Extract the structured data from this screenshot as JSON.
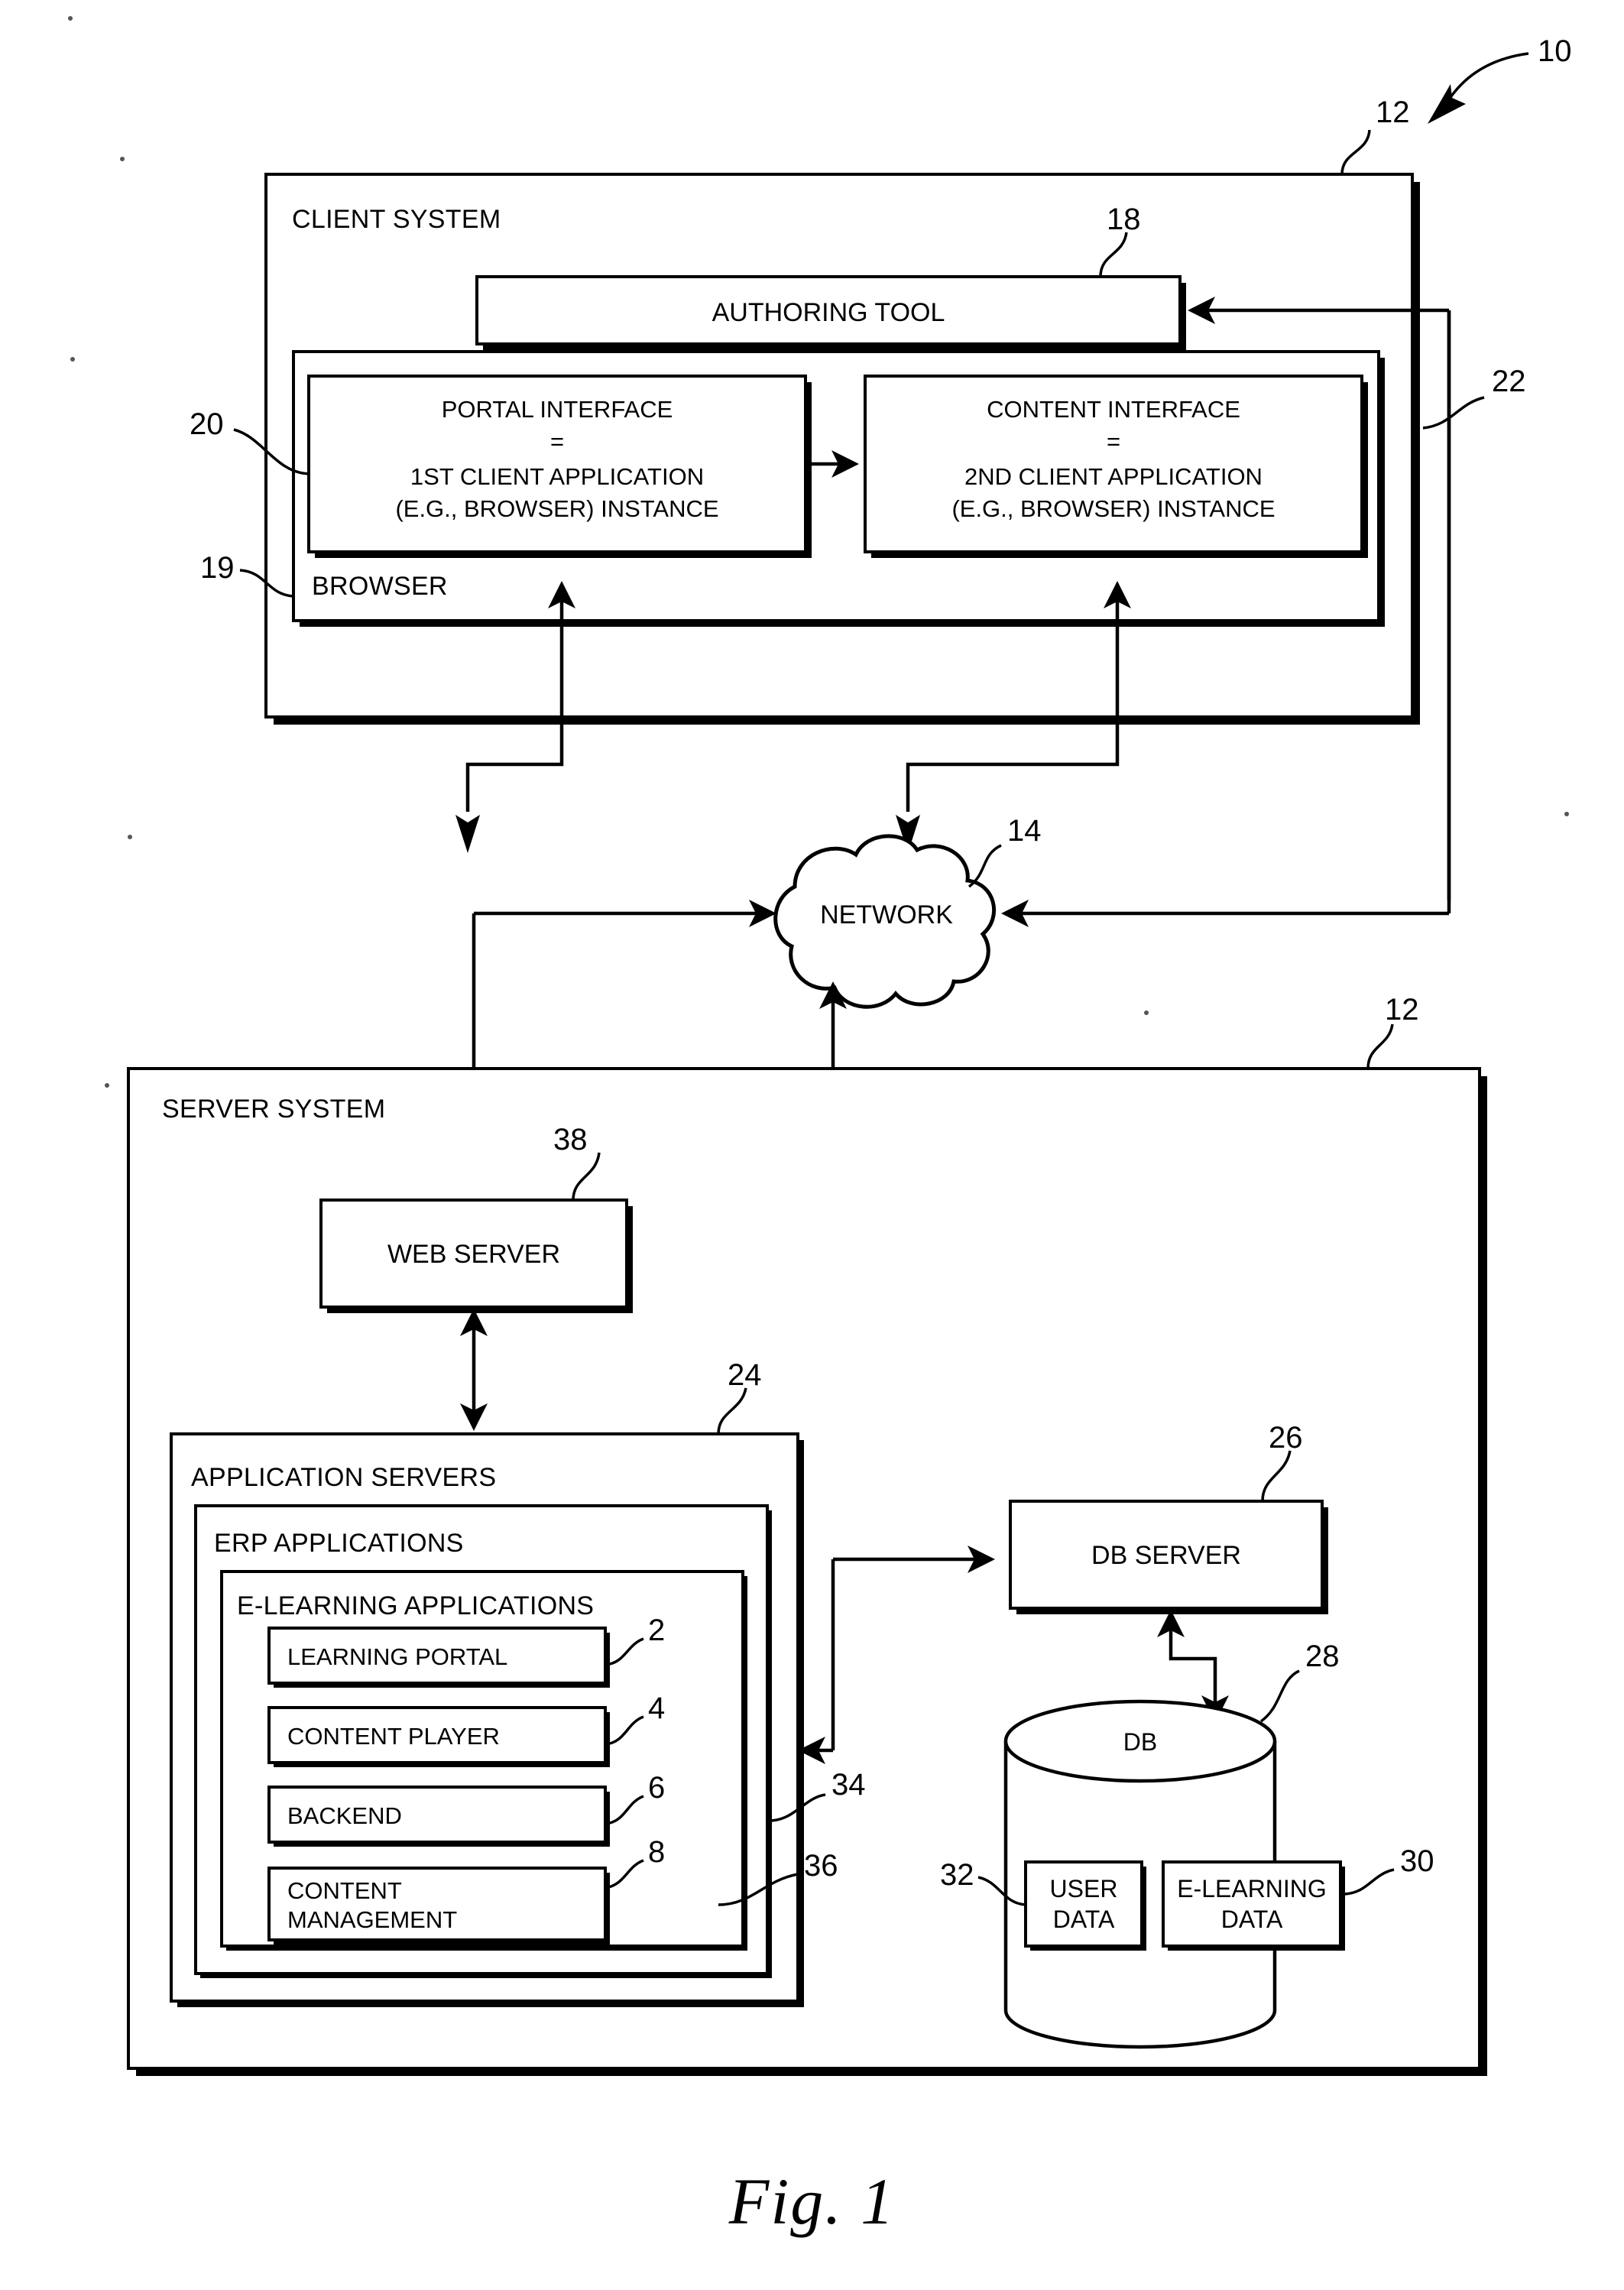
{
  "figure": {
    "caption": "Fig. 1",
    "system_ref": "10"
  },
  "client": {
    "title": "CLIENT SYSTEM",
    "ref": "12",
    "browser": {
      "label": "BROWSER",
      "ref": "19"
    },
    "authoring_tool": {
      "label": "AUTHORING TOOL",
      "ref": "18"
    },
    "portal_interface": {
      "line1": "PORTAL INTERFACE",
      "line2": "=",
      "line3": "1ST CLIENT APPLICATION",
      "line4": "(E.G., BROWSER) INSTANCE",
      "ref": "20"
    },
    "content_interface": {
      "line1": "CONTENT INTERFACE",
      "line2": "=",
      "line3": "2ND CLIENT APPLICATION",
      "line4": "(E.G., BROWSER) INSTANCE",
      "ref": "22"
    }
  },
  "network": {
    "label": "NETWORK",
    "ref": "14"
  },
  "server": {
    "title": "SERVER SYSTEM",
    "ref": "12",
    "web_server": {
      "label": "WEB SERVER",
      "ref": "38"
    },
    "application_servers": {
      "label": "APPLICATION SERVERS",
      "ref": "24"
    },
    "erp_applications": {
      "label": "ERP APPLICATIONS"
    },
    "elearning_applications": {
      "label": "E-LEARNING APPLICATIONS"
    },
    "modules": [
      {
        "label": "LEARNING PORTAL",
        "ref": "2"
      },
      {
        "label": "CONTENT PLAYER",
        "ref": "4"
      },
      {
        "label": "BACKEND",
        "ref": "6"
      },
      {
        "label": "CONTENT MANAGEMENT",
        "label_line1": "CONTENT",
        "label_line2": "MANAGEMENT",
        "ref": "8"
      }
    ],
    "connector_refs": {
      "backend_link": "34",
      "content_mgmt_link": "36"
    },
    "db_server": {
      "label": "DB SERVER",
      "ref": "26"
    },
    "db": {
      "label": "DB",
      "ref": "28",
      "stores": [
        {
          "label": "USER DATA",
          "line1": "USER",
          "line2": "DATA",
          "ref": "32"
        },
        {
          "label": "E-LEARNING DATA",
          "line1": "E-LEARNING",
          "line2": "DATA",
          "ref": "30"
        }
      ]
    }
  }
}
